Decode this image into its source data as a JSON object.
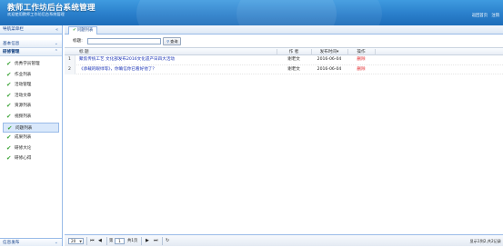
{
  "header": {
    "title": "教师工作坊后台系统管理",
    "subtitle": "欢迎使用教师工作坊后台系统管理",
    "links": [
      "返回首页",
      "注销"
    ]
  },
  "nav": {
    "title": "导航菜单栏",
    "sections": [
      "基本信息",
      "研修管理"
    ],
    "items": [
      "优秀学员管理",
      "作业列表",
      "活动管理",
      "活动文章",
      "资源列表",
      "视频列表",
      "问题列表",
      "成果列表",
      "研修大论",
      "研修心得"
    ],
    "selected_index": 6,
    "footer": "信息发布"
  },
  "main": {
    "tab_label": "问题列表",
    "filter": {
      "label": "标题:",
      "value": "",
      "button": "查询"
    },
    "columns": [
      "标 题",
      "作 者",
      "发布时间",
      "操作"
    ],
    "rows": [
      {
        "idx": "1",
        "title": "聚焦传统工艺 文化部发布2016文化遗产日四大活动",
        "author": "谢老文",
        "date": "2016-06-04",
        "op": "删除"
      },
      {
        "idx": "2",
        "title": "《承载的眼绿等》，你确信你已看好他了？",
        "author": "谢老文",
        "date": "2016-06-04",
        "op": "删除"
      }
    ]
  },
  "pager": {
    "page_size": "20",
    "page_label_prefix": "第",
    "page_value": "1",
    "page_label_suffix": "共1页",
    "info": "显示1到2,共2记录"
  }
}
